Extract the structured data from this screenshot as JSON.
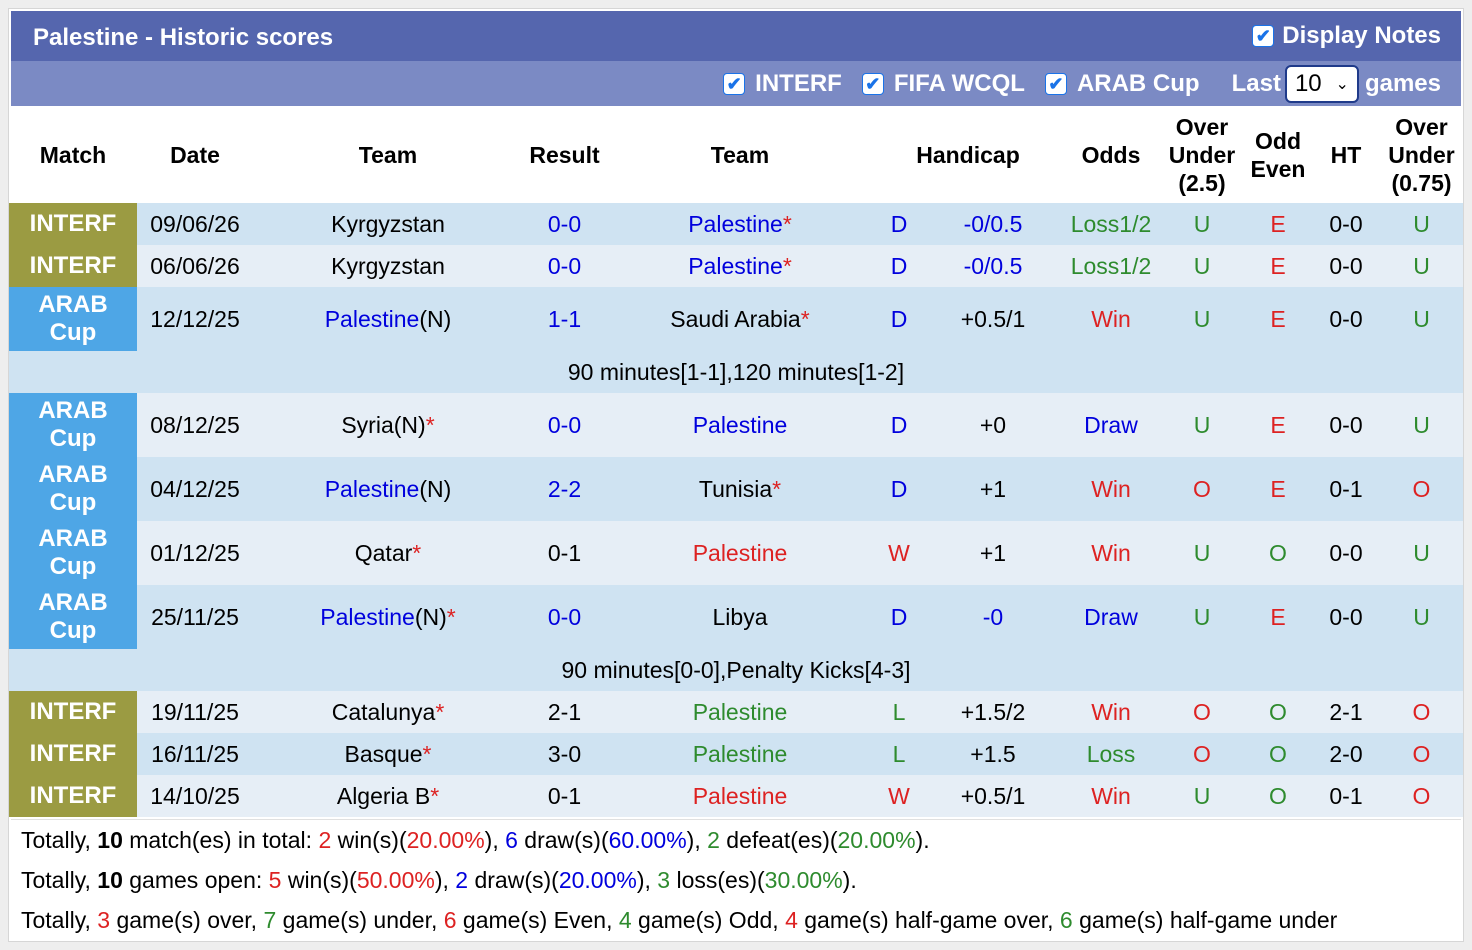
{
  "header": {
    "title": "Palestine - Historic scores",
    "display_notes": "Display Notes",
    "filters": [
      "INTERF",
      "FIFA WCQL",
      "ARAB Cup"
    ],
    "last_label": "Last",
    "last_value": "10",
    "games_label": "games"
  },
  "columns": [
    "Match",
    "Date",
    "Team",
    "Result",
    "Team",
    "Handicap",
    "Odds",
    "Over Under (2.5)",
    "Odd Even",
    "HT",
    "Over Under (0.75)"
  ],
  "matches": [
    {
      "comp": "INTERF",
      "date": "09/06/26",
      "home": "Kyrgyzstan",
      "away": "Palestine*",
      "score": "0-0",
      "hr": "D",
      "hcp": "-0/0.5",
      "odds": "Loss1/2",
      "ou": "U",
      "oe": "E",
      "ht": "0-0",
      "ou2": "U"
    },
    {
      "comp": "INTERF",
      "date": "06/06/26",
      "home": "Kyrgyzstan",
      "away": "Palestine*",
      "score": "0-0",
      "hr": "D",
      "hcp": "-0/0.5",
      "odds": "Loss1/2",
      "ou": "U",
      "oe": "E",
      "ht": "0-0",
      "ou2": "U"
    },
    {
      "comp": "ARAB Cup",
      "date": "12/12/25",
      "home": "Palestine(N)",
      "away": "Saudi Arabia*",
      "score": "1-1",
      "hr": "D",
      "hcp": "+0.5/1",
      "odds": "Win",
      "ou": "U",
      "oe": "E",
      "ht": "0-0",
      "ou2": "U",
      "note": "90 minutes[1-1],120 minutes[1-2]"
    },
    {
      "comp": "ARAB Cup",
      "date": "08/12/25",
      "home": "Syria(N)*",
      "away": "Palestine",
      "score": "0-0",
      "hr": "D",
      "hcp": "+0",
      "odds": "Draw",
      "ou": "U",
      "oe": "E",
      "ht": "0-0",
      "ou2": "U"
    },
    {
      "comp": "ARAB Cup",
      "date": "04/12/25",
      "home": "Palestine(N)",
      "away": "Tunisia*",
      "score": "2-2",
      "hr": "D",
      "hcp": "+1",
      "odds": "Win",
      "ou": "O",
      "oe": "E",
      "ht": "0-1",
      "ou2": "O"
    },
    {
      "comp": "ARAB Cup",
      "date": "01/12/25",
      "home": "Qatar*",
      "away": "Palestine",
      "score": "0-1",
      "hr": "W",
      "hcp": "+1",
      "odds": "Win",
      "ou": "U",
      "oe": "O",
      "ht": "0-0",
      "ou2": "U"
    },
    {
      "comp": "ARAB Cup",
      "date": "25/11/25",
      "home": "Palestine(N)*",
      "away": "Libya",
      "score": "0-0",
      "hr": "D",
      "hcp": "-0",
      "odds": "Draw",
      "ou": "U",
      "oe": "E",
      "ht": "0-0",
      "ou2": "U",
      "note": "90 minutes[0-0],Penalty Kicks[4-3]"
    },
    {
      "comp": "INTERF",
      "date": "19/11/25",
      "home": "Catalunya*",
      "away": "Palestine",
      "score": "2-1",
      "hr": "L",
      "hcp": "+1.5/2",
      "odds": "Win",
      "ou": "O",
      "oe": "O",
      "ht": "2-1",
      "ou2": "O"
    },
    {
      "comp": "INTERF",
      "date": "16/11/25",
      "home": "Basque*",
      "away": "Palestine",
      "score": "3-0",
      "hr": "L",
      "hcp": "+1.5",
      "odds": "Loss",
      "ou": "O",
      "oe": "O",
      "ht": "2-0",
      "ou2": "O"
    },
    {
      "comp": "INTERF",
      "date": "14/10/25",
      "home": "Algeria B*",
      "away": "Palestine",
      "score": "0-1",
      "hr": "W",
      "hcp": "+0.5/1",
      "odds": "Win",
      "ou": "U",
      "oe": "O",
      "ht": "0-1",
      "ou2": "O"
    }
  ],
  "summary": {
    "line1": {
      "total": "10",
      "wins": "2",
      "win_pct": "20.00%",
      "draws": "6",
      "draw_pct": "60.00%",
      "defeats": "2",
      "defeat_pct": "20.00%"
    },
    "line2": {
      "total": "10",
      "wins": "5",
      "win_pct": "50.00%",
      "draws": "2",
      "draw_pct": "20.00%",
      "losses": "3",
      "loss_pct": "30.00%"
    },
    "line3": {
      "over": "3",
      "under": "7",
      "even": "6",
      "odd": "4",
      "half_over": "4",
      "half_under": "6"
    }
  },
  "colors": {
    "header": "#5566ae",
    "subheader": "#7b8ac4",
    "interf": "#9b9b42",
    "arab": "#4ea6e6",
    "row_a": "#cfe3f2",
    "row_b": "#e6eef6",
    "blue": "#0000dd",
    "red": "#dd2222",
    "green": "#2e8b2e"
  }
}
